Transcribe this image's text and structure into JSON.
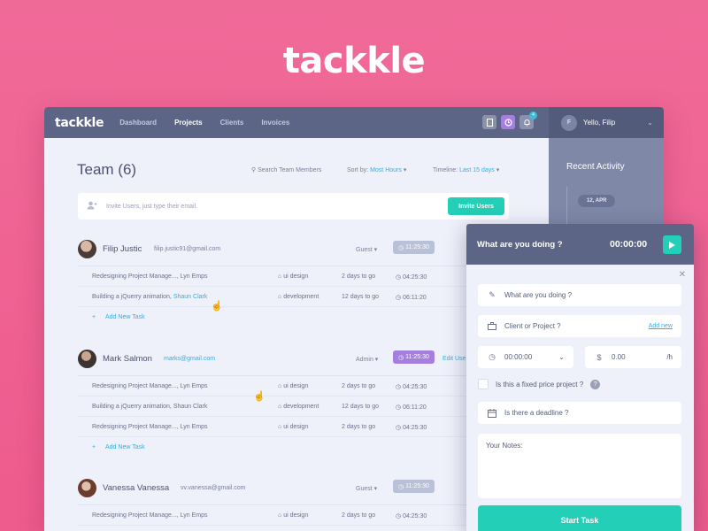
{
  "brand": "tackkle",
  "topbar": {
    "logo": "tackkle",
    "nav": [
      "Dashboard",
      "Projects",
      "Clients",
      "Invoices"
    ],
    "active_nav": "Projects",
    "notification_count": "4",
    "user_initial": "F",
    "greeting": "Yello, Filip"
  },
  "page": {
    "title": "Team (6)",
    "search_label": "Search Team Members",
    "sort_prefix": "Sort by:",
    "sort_value": "Most Hours",
    "timeline_prefix": "Timeline:",
    "timeline_value": "Last 15 days",
    "invite_placeholder": "Invite Users, just type their email.",
    "invite_button": "Invite Users",
    "add_task_label": "Add New Task",
    "edit_label": "Edit Use"
  },
  "members": [
    {
      "name": "Filip Justic",
      "email": "filip.justic91@gmail.com",
      "role": "Guest",
      "timer": "11:25:30",
      "tasks": [
        {
          "name": "Redesigning Project Manage..., Lyn Emps",
          "link": "",
          "tag": "ui design",
          "due": "2 days to go",
          "time": "04:25:30"
        },
        {
          "name": "Building a jQuerry animation, ",
          "link": "Shaun Clark",
          "tag": "development",
          "due": "12 days to go",
          "time": "06:11:20"
        }
      ]
    },
    {
      "name": "Mark Salmon",
      "email": "marks@gmail.com",
      "role": "Admin",
      "timer": "11:25:30",
      "tasks": [
        {
          "name": "Redesigning Project Manage..., Lyn Emps",
          "tag": "ui design",
          "due": "2 days to go",
          "time": "04:25:30"
        },
        {
          "name": "Building a jQuerry animation, Shaun Clark",
          "tag": "development",
          "due": "12 days to go",
          "time": "06:11:20"
        },
        {
          "name": "Redesigning Project Manage..., Lyn Emps",
          "tag": "ui design",
          "due": "2 days to go",
          "time": "04:25:30"
        }
      ]
    },
    {
      "name": "Vanessa Vanessa",
      "email": "vv.vanessa@gmail.com",
      "role": "Guest",
      "timer": "11:25:30",
      "tasks": [
        {
          "name": "Redesigning Project Manage..., Lyn Emps",
          "tag": "ui design",
          "due": "2 days to go",
          "time": "04:25:30"
        }
      ]
    }
  ],
  "recent_activity": {
    "title": "Recent Activity",
    "date": "12, APR"
  },
  "popup": {
    "header": "What are you doing ?",
    "clock": "00:00:00",
    "what_placeholder": "What are you doing ?",
    "client_placeholder": "Client or Project ?",
    "add_new": "Add new",
    "duration": "00:00:00",
    "currency": "$",
    "rate": "0.00",
    "rate_unit": "/h",
    "fixed_price": "Is this a fixed price project ?",
    "deadline": "Is there a deadline ?",
    "notes_label": "Your Notes:",
    "start_button": "Start Task"
  },
  "colors": {
    "background": "#ee5b8d",
    "topbar": "#5c6585",
    "accent_teal": "#23cfb6",
    "link_blue": "#35aee0",
    "purple_timer": "#a57fe0"
  }
}
